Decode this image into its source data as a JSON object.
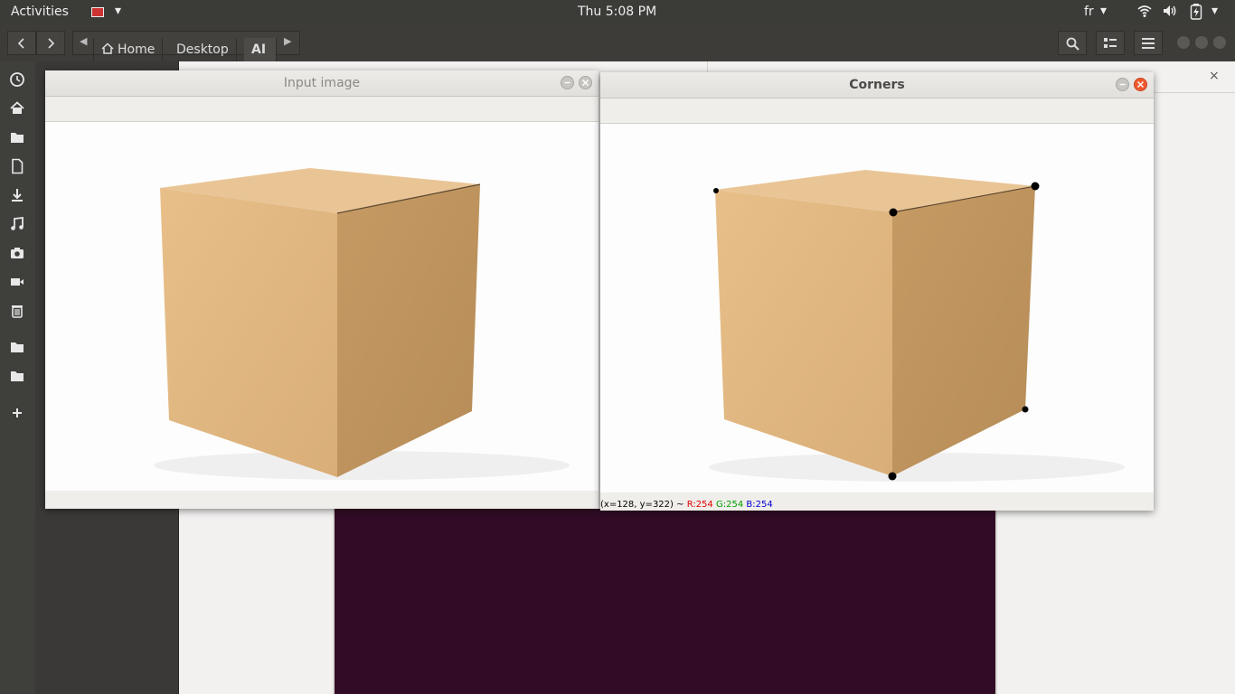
{
  "topbar": {
    "activities": "Activities",
    "clock": "Thu  5:08 PM",
    "language": "fr"
  },
  "header": {
    "breadcrumbs": [
      "Home",
      "Desktop",
      "AI"
    ]
  },
  "dock": {
    "icons": [
      "recent-icon",
      "home-icon",
      "documents-icon",
      "file-icon",
      "downloads-icon",
      "music-icon",
      "pictures-icon",
      "videos-icon",
      "trash-icon",
      "folder-icon",
      "folder-icon",
      "add-icon"
    ]
  },
  "input_window": {
    "title": "Input image"
  },
  "corners_window": {
    "title": "Corners"
  },
  "status": {
    "coords": "(x=128, y=322) ~",
    "r": "R:254",
    "g": "G:254",
    "b": "B:254",
    "r_color": "#e00000",
    "g_color": "#00a000",
    "b_color": "#0000d0"
  },
  "panel_close": "×"
}
